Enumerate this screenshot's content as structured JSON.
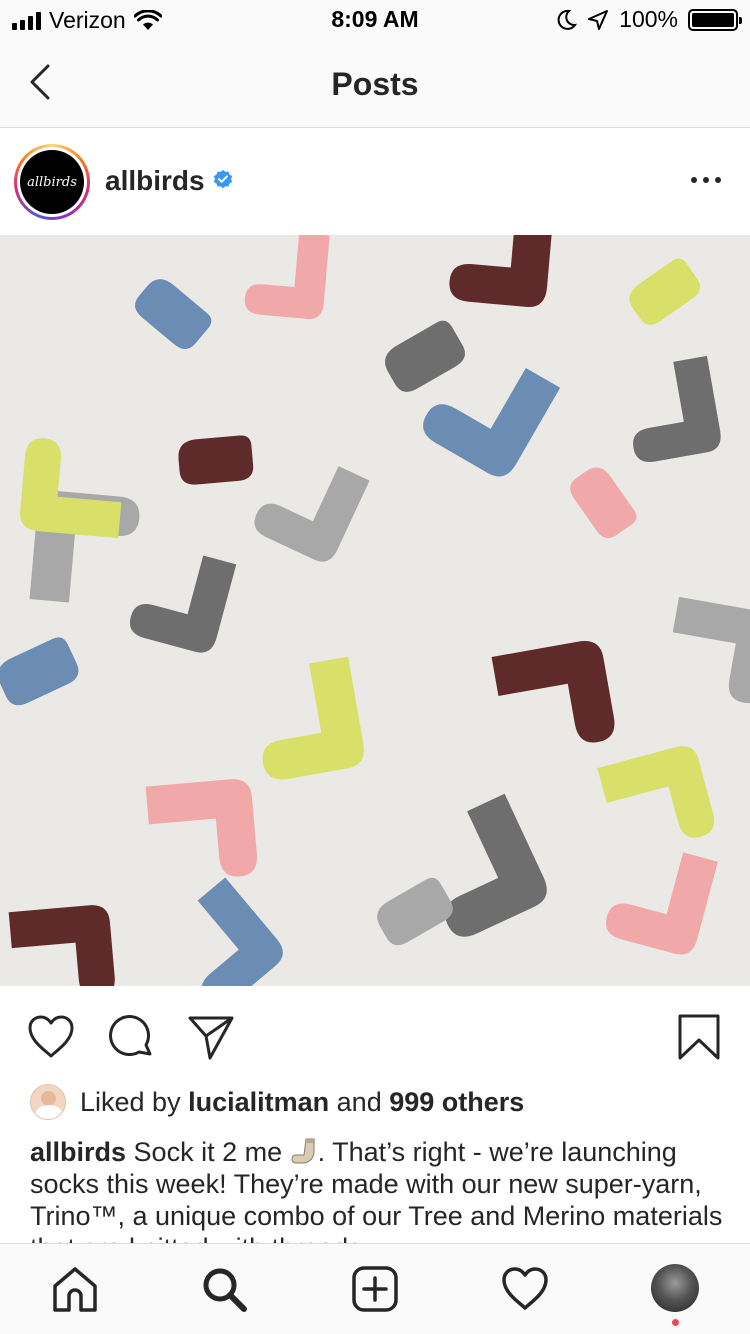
{
  "status_bar": {
    "carrier": "Verizon",
    "time": "8:09 AM",
    "battery": "100%",
    "icons": [
      "signal-icon",
      "wifi-icon",
      "moon-icon",
      "location-arrow-icon",
      "battery-icon"
    ]
  },
  "nav": {
    "title": "Posts",
    "back_icon": "chevron-left-icon"
  },
  "post": {
    "username": "allbirds",
    "avatar_text": "allbirds",
    "verified": true,
    "more_icon": "more-horizontal-icon",
    "image_subject": "socks",
    "actions": [
      "heart-icon",
      "comment-icon",
      "share-icon",
      "bookmark-icon"
    ],
    "likes": {
      "prefix": "Liked by",
      "user": "lucialitman",
      "conjunction": "and",
      "others": "999 others"
    },
    "caption": {
      "username": "allbirds",
      "text_before_emoji": "Sock it 2 me",
      "emoji": "sock-emoji",
      "text_after_emoji": ". That’s right - we’re launching socks this week! They’re made with our new super-yarn, Trino™, a unique combo of our Tree and Merino materials that are knitted with threads"
    }
  },
  "tab_bar": {
    "tabs": [
      "home-icon",
      "search-icon",
      "new-post-icon",
      "activity-heart-icon",
      "profile-avatar"
    ],
    "notification_color": "#ed4956"
  },
  "colors": {
    "background": "#ffffff",
    "bars": "#fafafa",
    "divider": "#dbdbdb",
    "text": "#262626",
    "verified": "#3897f0",
    "photo_bg": "#ebe9e6",
    "sock_colors": [
      "#a8a8a8",
      "#6b8cb3",
      "#f0a8a8",
      "#5e2a2a",
      "#d8e06a",
      "#6e6e6e",
      "#9c9c9c"
    ]
  }
}
